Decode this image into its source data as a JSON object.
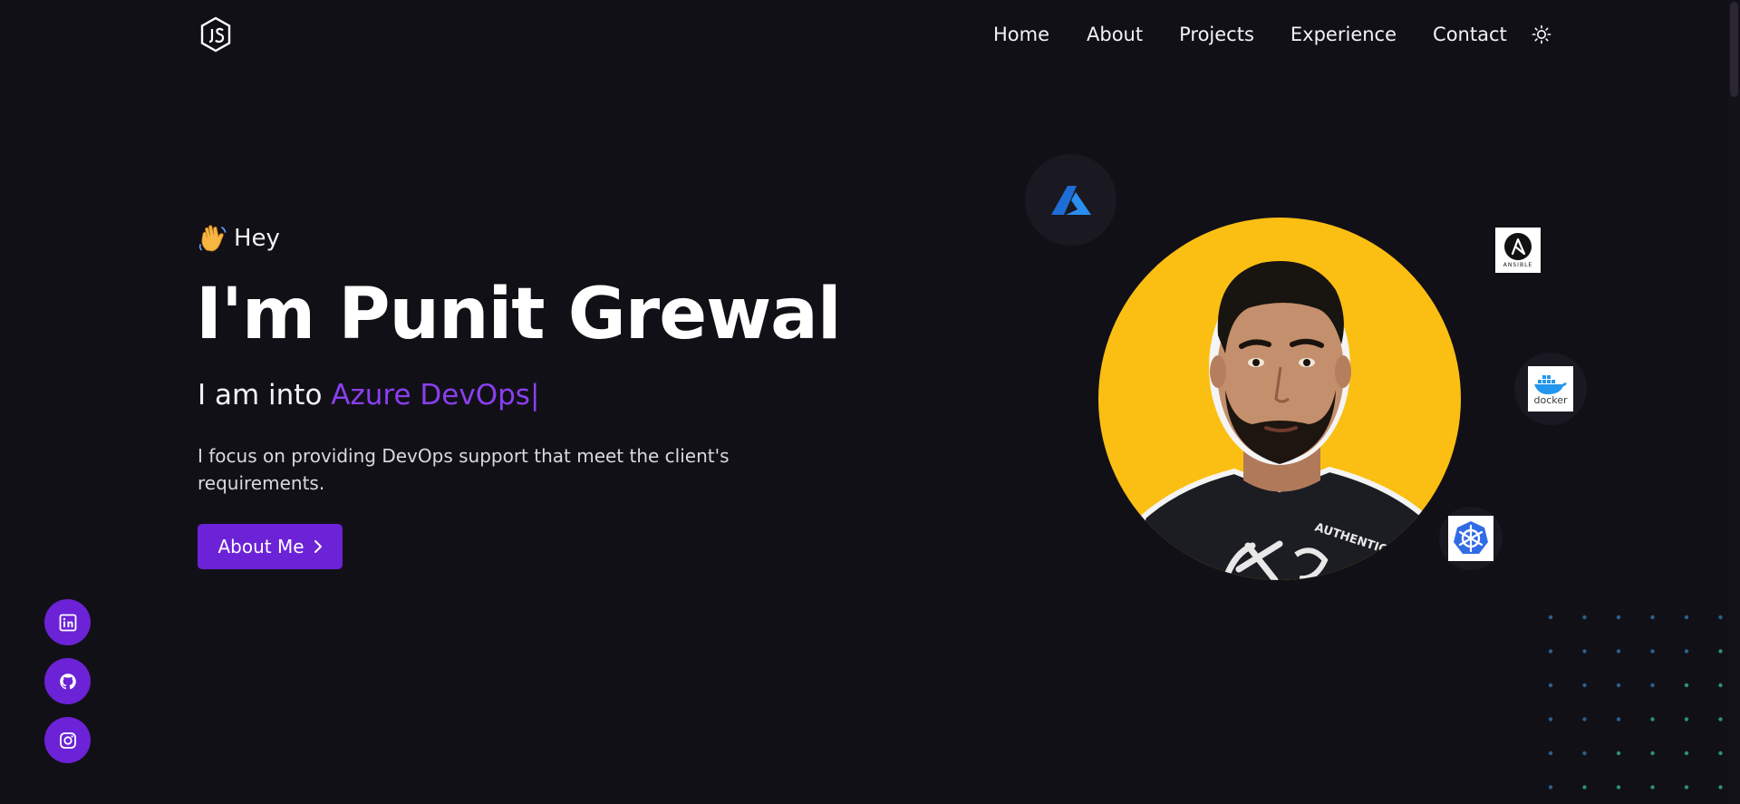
{
  "nav": {
    "links": [
      "Home",
      "About",
      "Projects",
      "Experience",
      "Contact"
    ]
  },
  "hero": {
    "greeting": "Hey",
    "name": "I'm Punit Grewal",
    "role_prefix": "I am into",
    "role_highlight": "Azure DevOps",
    "role_cursor": "|",
    "description": "I focus on providing DevOps support that meet the client's requirements.",
    "button_label": "About Me"
  },
  "tech_badges": {
    "ansible": "ANSIBLE",
    "docker": "docker"
  },
  "colors": {
    "background": "#121017",
    "accent": "#8a3ff0",
    "button": "#6c22d6",
    "photo_bg": "#fbbf14"
  },
  "icons": {
    "logo": "js-hexagon-icon",
    "theme": "sun-icon",
    "social": [
      "linkedin-icon",
      "github-icon",
      "instagram-icon"
    ],
    "tech": [
      "azure-icon",
      "ansible-icon",
      "docker-icon",
      "kubernetes-icon"
    ]
  }
}
